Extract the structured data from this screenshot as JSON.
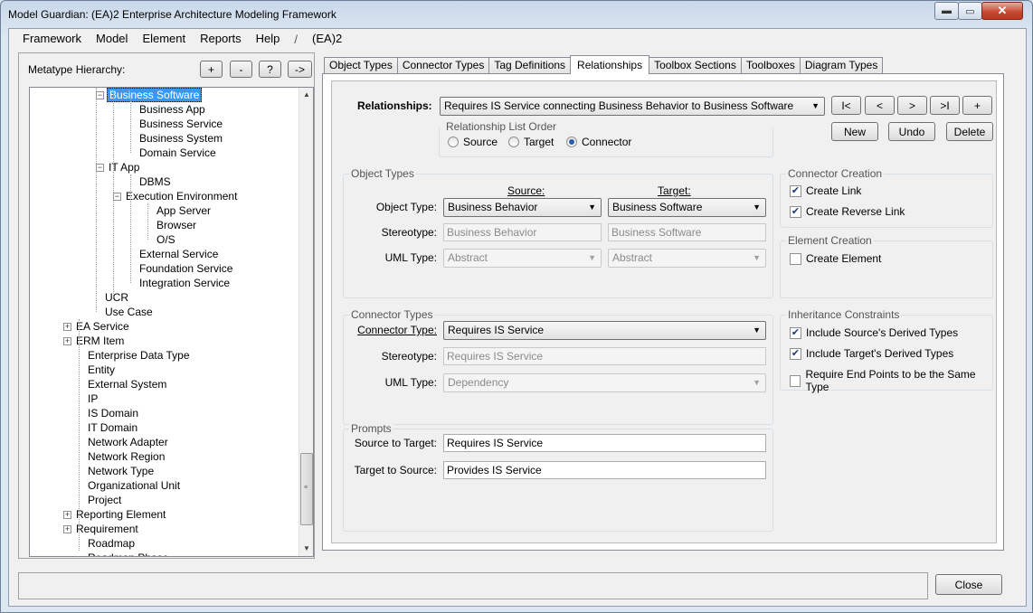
{
  "window": {
    "title": "Model Guardian: (EA)2 Enterprise Architecture Modeling Framework",
    "min_glyph": "▬",
    "max_glyph": "▭",
    "close_glyph": "✕"
  },
  "menu": {
    "items": [
      "Framework",
      "Model",
      "Element",
      "Reports",
      "Help"
    ],
    "separator": "/",
    "brand": "(EA)2"
  },
  "hierarchy": {
    "label": "Metatype Hierarchy:",
    "buttons": [
      "+",
      "-",
      "?",
      "->"
    ],
    "items": [
      {
        "label": "Business Software",
        "selected": true,
        "expander": "−"
      },
      {
        "label": "Business App"
      },
      {
        "label": "Business Service"
      },
      {
        "label": "Business System"
      },
      {
        "label": "Domain Service"
      },
      {
        "label": "IT App",
        "expander": "−"
      },
      {
        "label": "DBMS"
      },
      {
        "label": "Execution Environment",
        "expander": "−"
      },
      {
        "label": "App Server"
      },
      {
        "label": "Browser"
      },
      {
        "label": "O/S"
      },
      {
        "label": "External Service"
      },
      {
        "label": "Foundation Service"
      },
      {
        "label": "Integration Service"
      },
      {
        "label": "UCR"
      },
      {
        "label": "Use Case"
      },
      {
        "label": "EA Service",
        "expander": "+"
      },
      {
        "label": "ERM Item",
        "expander": "+"
      },
      {
        "label": "Enterprise Data Type"
      },
      {
        "label": "Entity"
      },
      {
        "label": "External System"
      },
      {
        "label": "IP"
      },
      {
        "label": "IS Domain"
      },
      {
        "label": "IT Domain"
      },
      {
        "label": "Network Adapter"
      },
      {
        "label": "Network Region"
      },
      {
        "label": "Network Type"
      },
      {
        "label": "Organizational Unit"
      },
      {
        "label": "Project"
      },
      {
        "label": "Reporting Element",
        "expander": "+"
      },
      {
        "label": "Requirement",
        "expander": "+"
      },
      {
        "label": "Roadmap"
      },
      {
        "label": "Roadmap Phase"
      }
    ]
  },
  "tabs": [
    "Object Types",
    "Connector Types",
    "Tag Definitions",
    "Relationships",
    "Toolbox Sections",
    "Toolboxes",
    "Diagram Types"
  ],
  "active_tab": "Relationships",
  "relationships": {
    "label": "Relationships:",
    "selected": "Requires IS Service connecting Business Behavior to Business Software",
    "nav_buttons": [
      "I<",
      "<",
      ">",
      ">I",
      "+"
    ],
    "action_buttons": [
      "New",
      "Undo",
      "Delete"
    ],
    "list_order": {
      "title": "Relationship List Order",
      "options": [
        "Source",
        "Target",
        "Connector"
      ],
      "selected": "Connector"
    }
  },
  "object_types": {
    "title": "Object Types",
    "source_header": "Source:",
    "target_header": "Target:",
    "rows": [
      {
        "label": "Object Type:",
        "source": "Business Behavior",
        "target": "Business Software"
      },
      {
        "label": "Stereotype:",
        "source": "Business Behavior",
        "target": "Business Software"
      },
      {
        "label": "UML Type:",
        "source": "Abstract",
        "target": "Abstract"
      }
    ]
  },
  "connector_types": {
    "title": "Connector Types",
    "rows": [
      {
        "label": "Connector Type:",
        "value": "Requires IS Service"
      },
      {
        "label": "Stereotype:",
        "value": "Requires IS Service"
      },
      {
        "label": "UML Type:",
        "value": "Dependency"
      }
    ]
  },
  "prompts": {
    "title": "Prompts",
    "rows": [
      {
        "label": "Source to Target:",
        "value": "Requires IS Service"
      },
      {
        "label": "Target to Source:",
        "value": "Provides IS Service"
      }
    ]
  },
  "connector_creation": {
    "title": "Connector Creation",
    "options": [
      {
        "label": "Create Link",
        "checked": true
      },
      {
        "label": "Create Reverse Link",
        "checked": true
      }
    ]
  },
  "element_creation": {
    "title": "Element Creation",
    "options": [
      {
        "label": "Create Element",
        "checked": false
      }
    ]
  },
  "inheritance": {
    "title": "Inheritance Constraints",
    "options": [
      {
        "label": "Include Source's Derived Types",
        "checked": true
      },
      {
        "label": "Include Target's Derived Types",
        "checked": true
      },
      {
        "label": "Require End Points to be the Same Type",
        "checked": false
      }
    ]
  },
  "footer": {
    "close_label": "Close"
  },
  "glyphs": {
    "dropdown": "▼",
    "check": "✔",
    "scroll_up": "▲",
    "scroll_down": "▼",
    "grip": "≡"
  }
}
